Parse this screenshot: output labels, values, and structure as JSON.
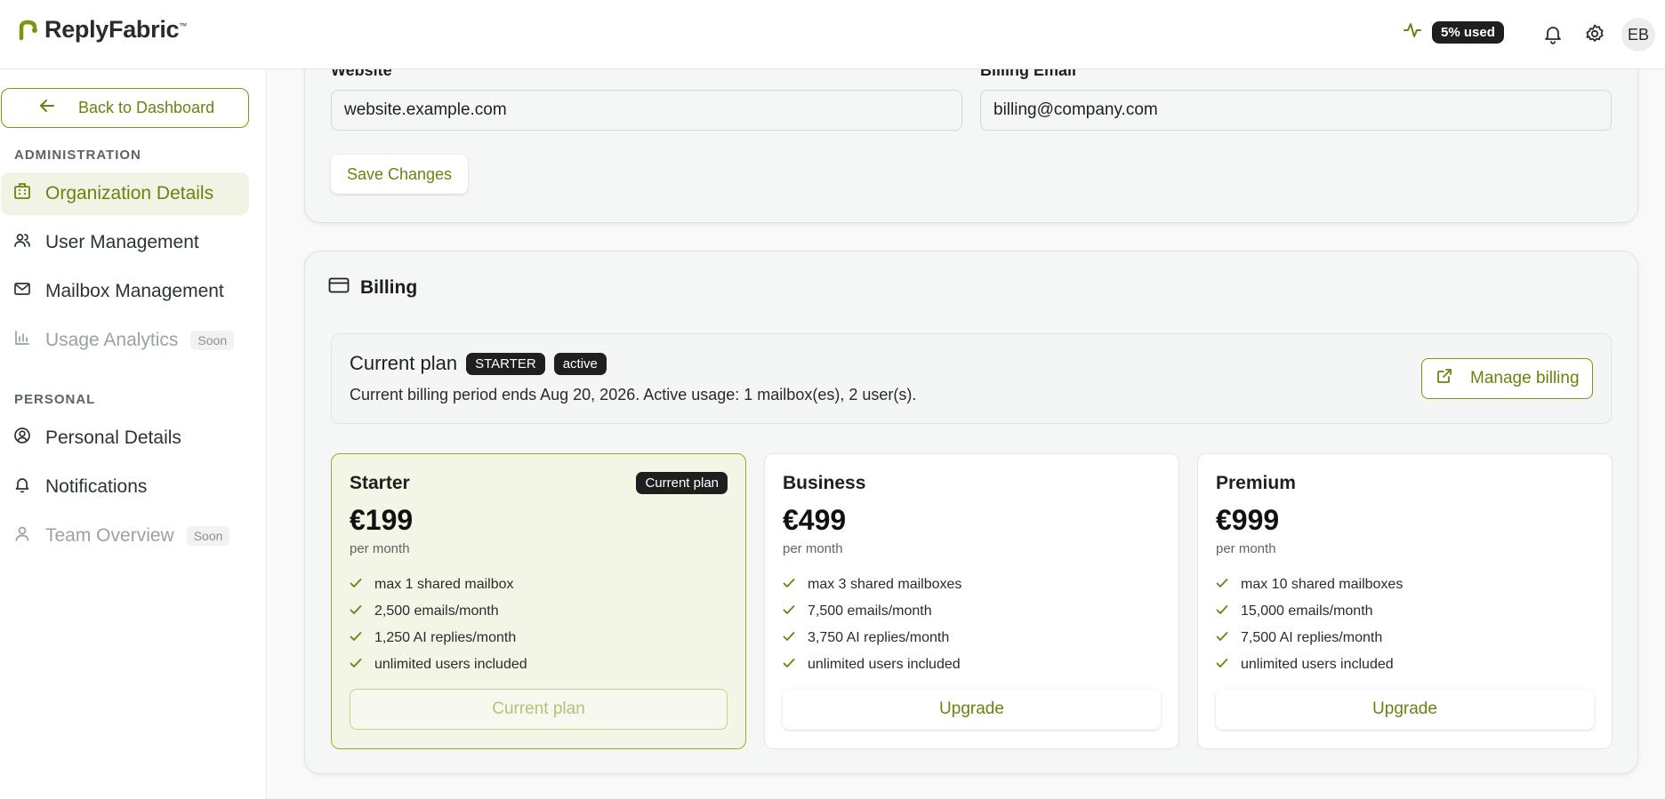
{
  "app": {
    "name": "ReplyFabric",
    "trademark": "™"
  },
  "header": {
    "usage_label": "5% used",
    "avatar_initials": "EB"
  },
  "sidebar": {
    "back_label": "Back to Dashboard",
    "admin_section": "ADMINISTRATION",
    "admin_items": [
      {
        "label": "Organization Details",
        "icon": "building-icon",
        "active": true
      },
      {
        "label": "User Management",
        "icon": "users-icon"
      },
      {
        "label": "Mailbox Management",
        "icon": "mail-icon"
      },
      {
        "label": "Usage Analytics",
        "icon": "bar-chart-icon",
        "badge": "Soon",
        "disabled": true
      }
    ],
    "personal_section": "PERSONAL",
    "personal_items": [
      {
        "label": "Personal Details",
        "icon": "user-circle-icon"
      },
      {
        "label": "Notifications",
        "icon": "bell-icon"
      },
      {
        "label": "Team Overview",
        "icon": "user-icon",
        "badge": "Soon",
        "disabled": true
      }
    ]
  },
  "org_form": {
    "website_label": "Website",
    "website_value": "website.example.com",
    "billing_email_label": "Billing Email",
    "billing_email_value": "billing@company.com",
    "save_label": "Save Changes"
  },
  "billing": {
    "title": "Billing",
    "current_plan_label": "Current plan",
    "plan_badge": "STARTER",
    "status_badge": "active",
    "description": "Current billing period ends Aug 20, 2026. Active usage: 1 mailbox(es), 2 user(s).",
    "manage_label": "Manage billing",
    "tiers": [
      {
        "name": "Starter",
        "badge": "Current plan",
        "price": "€199",
        "period": "per month",
        "features": [
          "max 1 shared mailbox",
          "2,500 emails/month",
          "1,250 AI replies/month",
          "unlimited users included"
        ],
        "button": "Current plan",
        "current": true
      },
      {
        "name": "Business",
        "price": "€499",
        "period": "per month",
        "features": [
          "max 3 shared mailboxes",
          "7,500 emails/month",
          "3,750 AI replies/month",
          "unlimited users included"
        ],
        "button": "Upgrade"
      },
      {
        "name": "Premium",
        "price": "€999",
        "period": "per month",
        "features": [
          "max 10 shared mailboxes",
          "15,000 emails/month",
          "7,500 AI replies/month",
          "unlimited users included"
        ],
        "button": "Upgrade"
      }
    ]
  },
  "colors": {
    "accent": "#6b8210",
    "accent_border": "#7d9410",
    "active_bg": "#f1f3e4",
    "badge_dark": "#1f1f1f"
  }
}
